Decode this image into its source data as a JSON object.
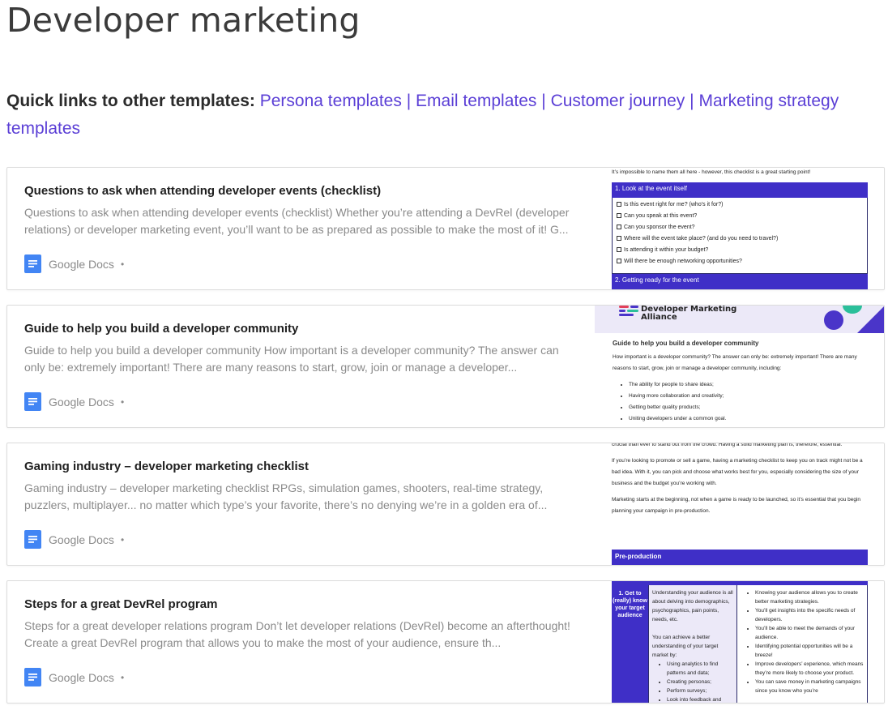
{
  "page": {
    "title": "Developer marketing"
  },
  "quick_links": {
    "label": "Quick links to other templates:",
    "separator": "|",
    "links": [
      "Persona templates",
      "Email templates",
      "Customer journey",
      "Marketing strategy templates"
    ]
  },
  "cards": [
    {
      "title": "Questions to ask when attending developer events (checklist)",
      "description": "Questions to ask when attending developer events (checklist) Whether you’re attending a DevRel (developer relations) or developer marketing event, you’ll want to be as prepared as possible to make the most of it! G...",
      "source": "Google Docs",
      "dot": "•",
      "thumb": {
        "intro": "It’s impossible to name them all here - however, this checklist is a great starting point!",
        "section1": "1. Look at the event itself",
        "items": [
          "Is this event right for me? (who’s it for?)",
          "Can you speak at this event?",
          "Can you sponsor the event?",
          "Where will the event take place? (and do you need to travel?)",
          "Is attending it within your budget?",
          "Will there be enough networking opportunities?"
        ],
        "section2": "2. Getting ready for the event"
      }
    },
    {
      "title": "Guide to help you build a developer community",
      "description": "Guide to help you build a developer community How important is a developer community? The answer can only be: extremely important! There are many reasons to start, grow, join or manage a developer...",
      "source": "Google Docs",
      "dot": "•",
      "thumb": {
        "logo_line1": "Developer Marketing",
        "logo_line2": "Alliance",
        "heading": "Guide to help you build a developer community",
        "para": "How important is a developer community? The answer can only be: extremely important! There are many reasons to start, grow, join or manage a developer community, including:",
        "items": [
          "The ability for people to share ideas;",
          "Having more collaboration and creativity;",
          "Getting better quality products;",
          "Uniting developers under a common goal."
        ]
      }
    },
    {
      "title": "Gaming industry – developer marketing checklist",
      "description": "Gaming industry – developer marketing checklist RPGs, simulation games, shooters, real-time strategy, puzzlers, multiplayer... no matter which type’s your favorite, there’s no denying we’re in a golden era of...",
      "source": "Google Docs",
      "dot": "•",
      "thumb": {
        "para0": "crucial than ever to stand out from the crowd. Having a solid marketing plan is, therefore, essential.",
        "para1": "If you’re looking to promote or sell a game, having a marketing checklist to keep you on track might not be a bad idea. With it, you can pick and choose what works best for you, especially considering the size of your business and the budget you’re working with.",
        "para2": "Marketing starts at the beginning, not when a game is ready to be launched, so it’s essential that you begin planning your campaign in pre-production.",
        "band": "Pre-production"
      }
    },
    {
      "title": "Steps for a great DevRel program",
      "description": "Steps for a great developer relations program Don’t let developer relations (DevRel) become an afterthought! Create a great DevRel program that allows you to make the most of your audience, ensure th...",
      "source": "Google Docs",
      "dot": "•",
      "thumb": {
        "col1": "1. Get to (really) know your target audience",
        "col2_para": "Understanding your audience is all about delving into demographics, psychographics, pain points, needs, etc.",
        "col2_para2": "You can achieve a better understanding of your target market by:",
        "col2_items": [
          "Using analytics to find patterns and data;",
          "Creating personas;",
          "Perform surveys;",
          "Look into feedback and"
        ],
        "col3_items": [
          "Knowing your audience allows you to create better marketing strategies.",
          "You’ll get insights into the specific needs of developers.",
          "You’ll be able to meet the demands of your audience.",
          "Identifying potential opportunities will be a breeze!",
          "Improve developers’ experience, which means they’re more likely to choose your product.",
          "You can save money in marketing campaigns since you know who you’re"
        ]
      }
    }
  ],
  "colors": {
    "link": "#5b3fd6",
    "band": "#3f2fc7",
    "gdocs_blue": "#4285f4"
  }
}
